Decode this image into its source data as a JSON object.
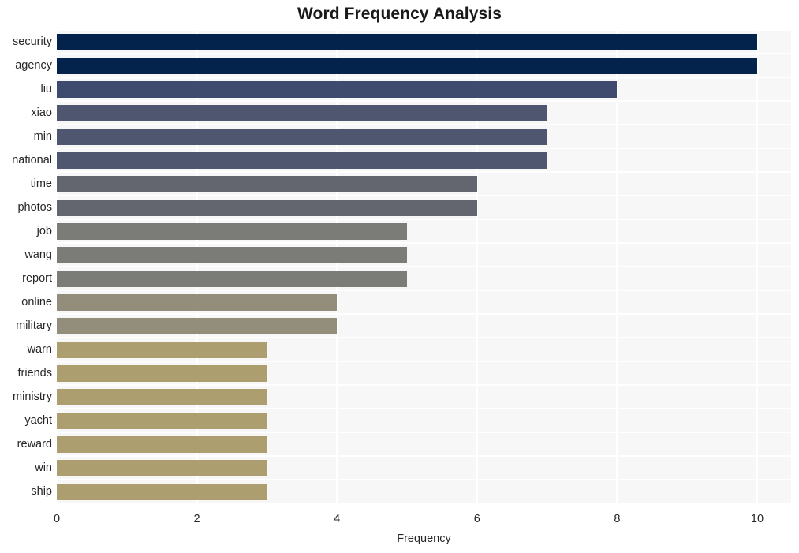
{
  "chart_data": {
    "type": "bar",
    "orientation": "horizontal",
    "title": "Word Frequency Analysis",
    "xlabel": "Frequency",
    "ylabel": "",
    "xlim": [
      0,
      10
    ],
    "xticks": [
      "0",
      "2",
      "4",
      "6",
      "8",
      "10"
    ],
    "xtick_values": [
      0,
      2,
      4,
      6,
      8,
      10
    ],
    "grid": true,
    "grid_color": "#ffffff",
    "plot_background": "#f7f7f7",
    "figure_background": "#ffffff",
    "legend": null,
    "categories": [
      "security",
      "agency",
      "liu",
      "xiao",
      "min",
      "national",
      "time",
      "photos",
      "job",
      "wang",
      "report",
      "online",
      "military",
      "warn",
      "friends",
      "ministry",
      "yacht",
      "reward",
      "win",
      "ship"
    ],
    "values": [
      10,
      10,
      8,
      7,
      7,
      7,
      6,
      6,
      5,
      5,
      5,
      4,
      4,
      3,
      3,
      3,
      3,
      3,
      3,
      3
    ],
    "bar_colors": [
      "#03224c",
      "#03224c",
      "#3e4a6e",
      "#4e5670",
      "#4e5670",
      "#4e5670",
      "#63666f",
      "#63666f",
      "#7b7b78",
      "#7b7b78",
      "#7b7b78",
      "#928e7b",
      "#928e7b",
      "#ac9e6e",
      "#ac9e6e",
      "#ac9e6e",
      "#ac9e6e",
      "#ac9e6e",
      "#ac9e6e",
      "#ac9e6e"
    ],
    "bars": [
      {
        "label": "security",
        "value": 10,
        "color": "#03224c"
      },
      {
        "label": "agency",
        "value": 10,
        "color": "#03224c"
      },
      {
        "label": "liu",
        "value": 8,
        "color": "#3e4a6e"
      },
      {
        "label": "xiao",
        "value": 7,
        "color": "#4e5670"
      },
      {
        "label": "min",
        "value": 7,
        "color": "#4e5670"
      },
      {
        "label": "national",
        "value": 7,
        "color": "#4e5670"
      },
      {
        "label": "time",
        "value": 6,
        "color": "#63666f"
      },
      {
        "label": "photos",
        "value": 6,
        "color": "#63666f"
      },
      {
        "label": "job",
        "value": 5,
        "color": "#7b7b78"
      },
      {
        "label": "wang",
        "value": 5,
        "color": "#7b7b78"
      },
      {
        "label": "report",
        "value": 5,
        "color": "#7b7b78"
      },
      {
        "label": "online",
        "value": 4,
        "color": "#928e7b"
      },
      {
        "label": "military",
        "value": 4,
        "color": "#928e7b"
      },
      {
        "label": "warn",
        "value": 3,
        "color": "#ac9e6e"
      },
      {
        "label": "friends",
        "value": 3,
        "color": "#ac9e6e"
      },
      {
        "label": "ministry",
        "value": 3,
        "color": "#ac9e6e"
      },
      {
        "label": "yacht",
        "value": 3,
        "color": "#ac9e6e"
      },
      {
        "label": "reward",
        "value": 3,
        "color": "#ac9e6e"
      },
      {
        "label": "win",
        "value": 3,
        "color": "#ac9e6e"
      },
      {
        "label": "ship",
        "value": 3,
        "color": "#ac9e6e"
      }
    ]
  }
}
